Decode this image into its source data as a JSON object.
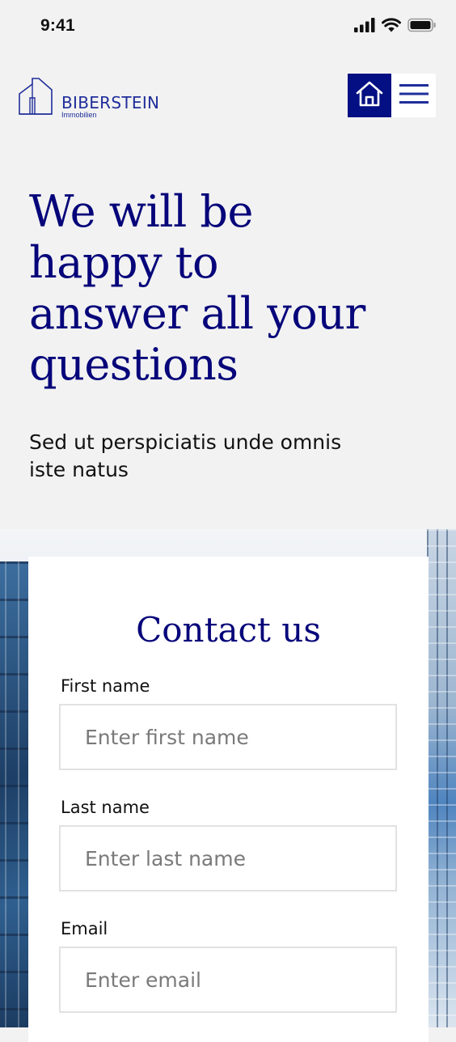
{
  "status_bar": {
    "time": "9:41",
    "icons": [
      "signal-icon",
      "wifi-icon",
      "battery-icon"
    ]
  },
  "header": {
    "logo": {
      "name": "BIBERSTEIN",
      "subtitle": "Immobilien"
    },
    "home_icon": "home-icon",
    "menu_icon": "hamburger-menu-icon"
  },
  "hero": {
    "title_lines": [
      "We will be",
      "happy to",
      "answer all your",
      "questions"
    ],
    "subtitle_lines": [
      "Sed ut perspiciatis unde omnis",
      "iste natus"
    ]
  },
  "contact": {
    "title": "Contact us",
    "fields": [
      {
        "label": "First name",
        "placeholder": "Enter first name"
      },
      {
        "label": "Last name",
        "placeholder": "Enter last name"
      },
      {
        "label": "Email",
        "placeholder": "Enter email"
      }
    ]
  },
  "colors": {
    "brand_navy": "#06057a",
    "button_navy": "#030f82",
    "logo_blue": "#1f2e9a",
    "page_bg": "#f2f2f2"
  }
}
